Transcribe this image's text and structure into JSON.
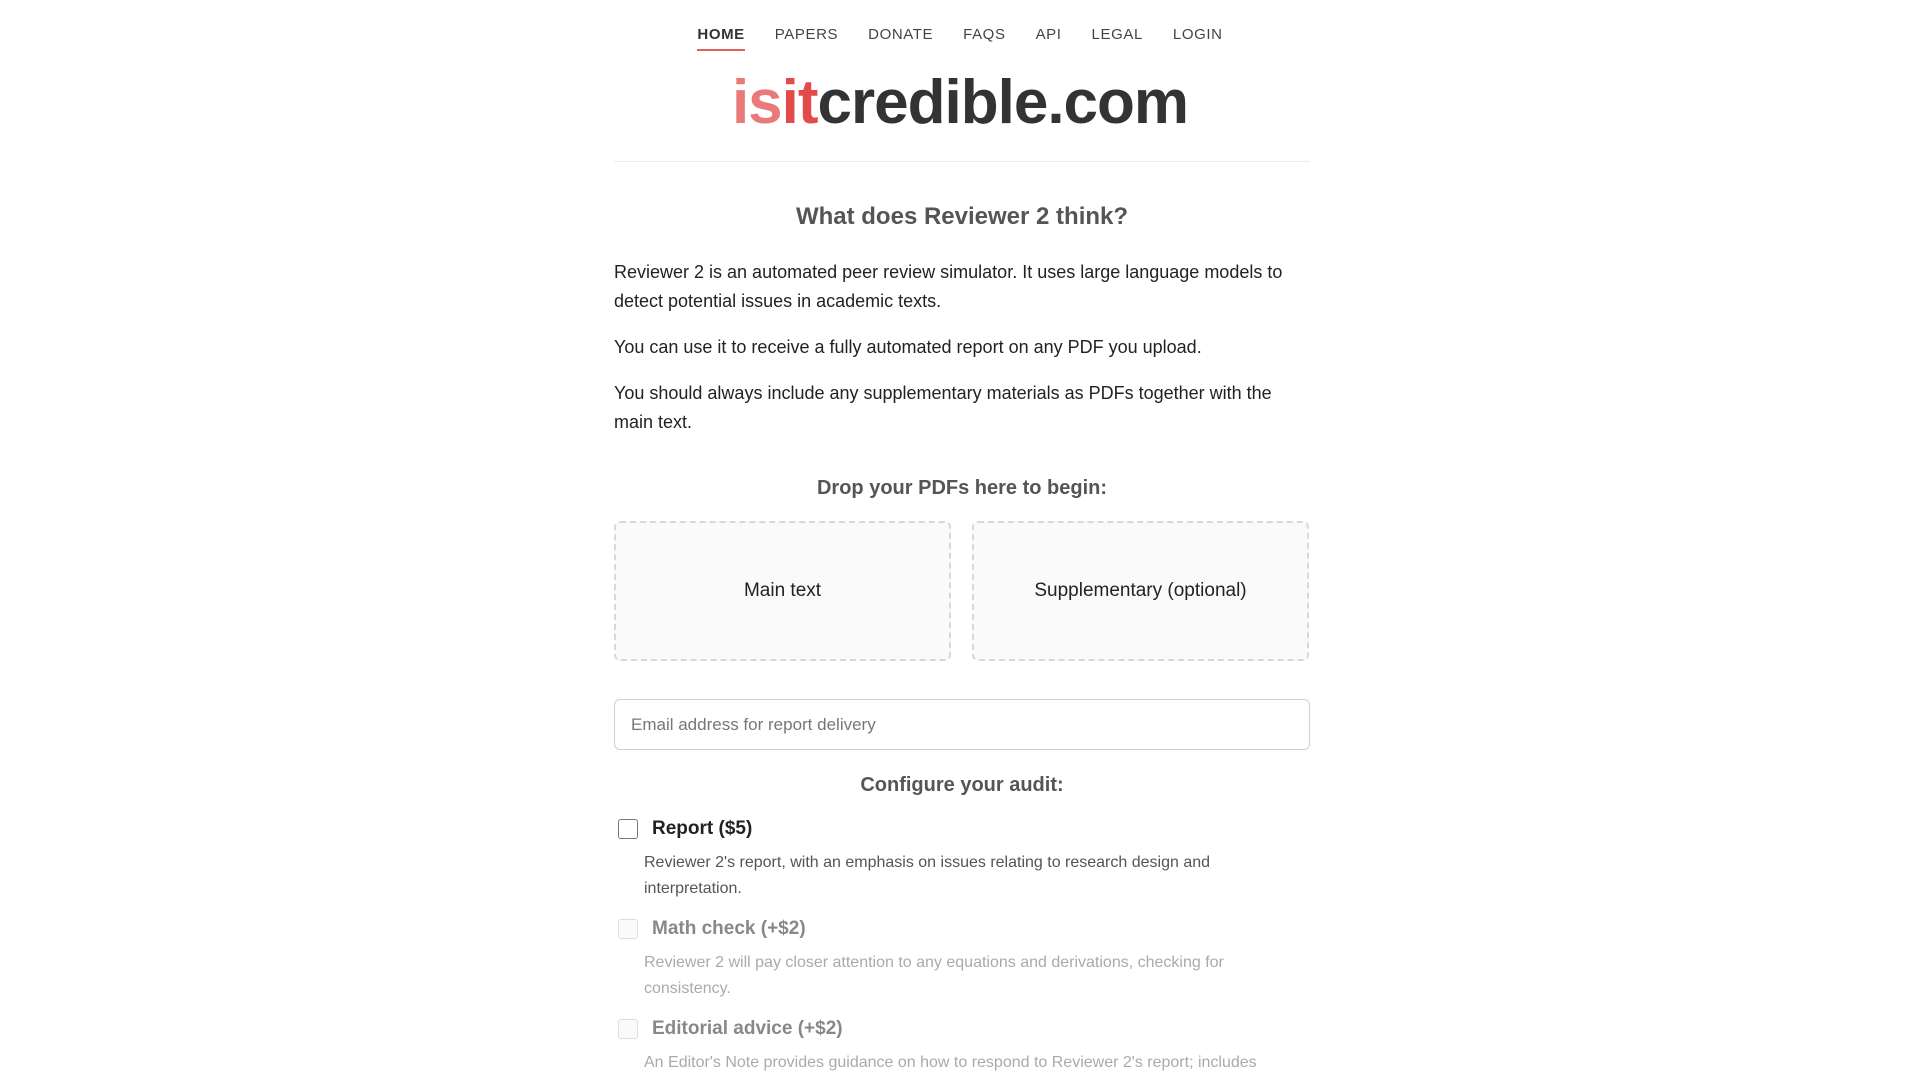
{
  "nav": {
    "items": [
      {
        "label": "HOME",
        "active": true
      },
      {
        "label": "PAPERS"
      },
      {
        "label": "DONATE"
      },
      {
        "label": "FAQS"
      },
      {
        "label": "API"
      },
      {
        "label": "LEGAL"
      },
      {
        "label": "LOGIN"
      }
    ]
  },
  "logo": {
    "part1": "is",
    "part2": "it",
    "part3": "credible.com"
  },
  "main": {
    "heading": "What does Reviewer 2 think?",
    "paragraphs": [
      "Reviewer 2 is an automated peer review simulator. It uses large language models to detect potential issues in academic texts.",
      "You can use it to receive a fully automated report on any PDF you upload.",
      "You should always include any supplementary materials as PDFs together with the main text."
    ],
    "drop_heading": "Drop your PDFs here to begin:",
    "drop_main": "Main text",
    "drop_supp": "Supplementary (optional)",
    "email_placeholder": "Email address for report delivery",
    "config_heading": "Configure your audit:",
    "options": [
      {
        "label": "Report ($5)",
        "desc": "Reviewer 2's report, with an emphasis on issues relating to research design and interpretation."
      },
      {
        "label": "Math check (+$2)",
        "desc": "Reviewer 2 will pay closer attention to any equations and derivations, checking for consistency."
      },
      {
        "label": "Editorial advice (+$2)",
        "desc": "An Editor's Note provides guidance on how to respond to Reviewer 2's report; includes"
      }
    ]
  },
  "colors": {
    "accent": "#e06060",
    "logo_is": "#ea7a7a",
    "logo_it": "#e34b4b",
    "logo_credible": "#333333"
  }
}
